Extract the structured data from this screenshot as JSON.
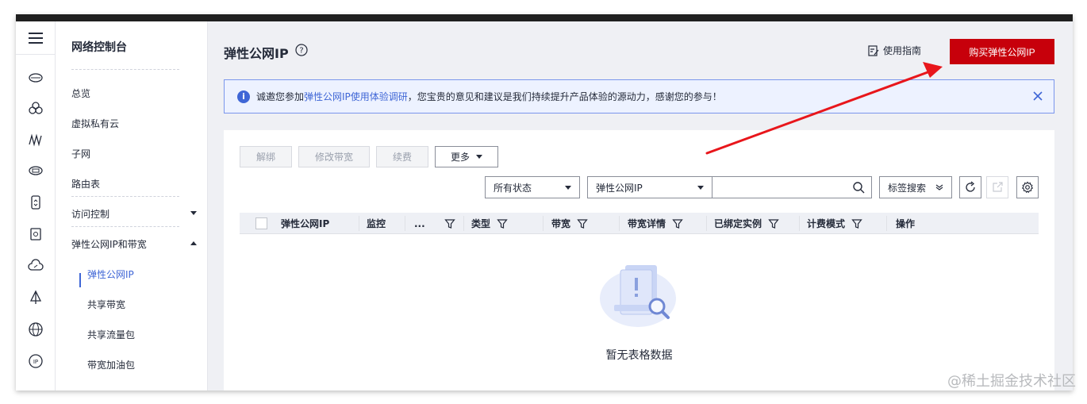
{
  "sidebar": {
    "icons": [
      "menu-icon",
      "cloud-eip-icon",
      "vpc-cluster-icon",
      "bandwidth-icon",
      "gateway-icon",
      "router-icon",
      "security-icon",
      "cloud-connect-icon",
      "sail-icon",
      "globe-icon",
      "ip-icon"
    ]
  },
  "subnav": {
    "title": "网络控制台",
    "items": {
      "overview": "总览",
      "vpc": "虚拟私有云",
      "subnet": "子网",
      "route_table": "路由表",
      "access_control": "访问控制",
      "eip_bandwidth": "弹性公网IP和带宽",
      "eip": "弹性公网IP",
      "shared_bandwidth": "共享带宽",
      "shared_data": "共享流量包",
      "bandwidth_addon": "带宽加油包"
    }
  },
  "header": {
    "title": "弹性公网IP",
    "guide": "使用指南",
    "buy_button": "购买弹性公网IP"
  },
  "notice": {
    "prefix": "诚邀您参加",
    "link": "弹性公网IP使用体验调研",
    "suffix": "，您宝贵的意见和建议是我们持续提升产品体验的源动力，感谢您的参与！"
  },
  "toolbar": {
    "unbind": "解绑",
    "modify_bandwidth": "修改带宽",
    "renew": "续费",
    "more": "更多",
    "status_filter": "所有状态",
    "search_field": "弹性公网IP",
    "tag_search": "标签搜索"
  },
  "table": {
    "columns": {
      "eip": "弹性公网IP",
      "monitor": "监控",
      "ellipsis": "...",
      "type": "类型",
      "bandwidth": "带宽",
      "bandwidth_detail": "带宽详情",
      "bound_instance": "已绑定实例",
      "billing": "计费模式",
      "operation": "操作"
    },
    "empty": "暂无表格数据"
  },
  "watermark": "@稀土掘金技术社区",
  "colors": {
    "primary_red": "#c7000b",
    "link_blue": "#3f66d6",
    "notice_bg": "#edf2ff",
    "arrow_red": "#e8161b"
  }
}
